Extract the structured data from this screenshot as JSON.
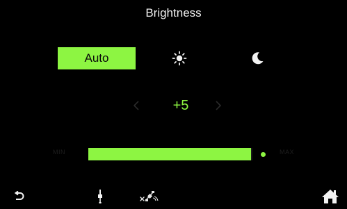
{
  "title": "Brightness",
  "modes": {
    "auto_label": "Auto",
    "selected": "auto",
    "day_icon": "sun-icon",
    "night_icon": "moon-icon"
  },
  "adjust": {
    "value": "+5",
    "left_icon": "chevron-left-icon",
    "right_icon": "chevron-right-icon"
  },
  "slider": {
    "min_label": "MIN",
    "max_label": "MAX",
    "level_fraction": 0.985
  },
  "bottom_bar": {
    "back_icon": "back-arrow-icon",
    "usb_icon": "usb-icon",
    "gps_icon": "gps-off-icon",
    "home_icon": "home-icon"
  },
  "colors": {
    "accent": "#8df542",
    "background": "#000000",
    "text": "#f0f0f0",
    "dim": "#2a2a2a"
  }
}
